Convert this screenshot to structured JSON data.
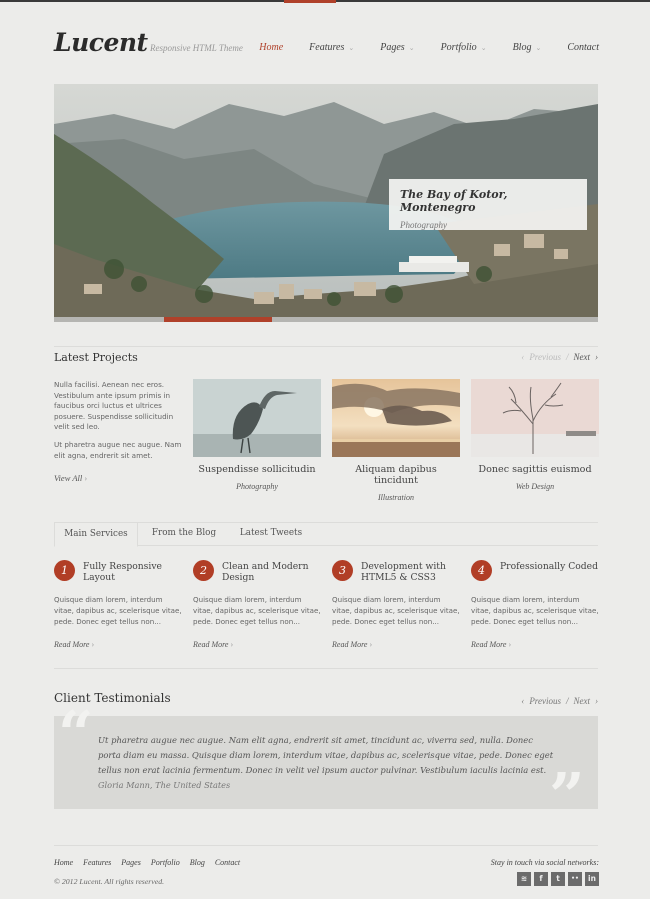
{
  "brand": {
    "logo": "Lucent",
    "tagline": "Responsive HTML Theme"
  },
  "nav": [
    {
      "label": "Home",
      "active": true,
      "has_submenu": false
    },
    {
      "label": "Features",
      "active": false,
      "has_submenu": true
    },
    {
      "label": "Pages",
      "active": false,
      "has_submenu": true
    },
    {
      "label": "Portfolio",
      "active": false,
      "has_submenu": true
    },
    {
      "label": "Blog",
      "active": false,
      "has_submenu": true
    },
    {
      "label": "Contact",
      "active": false,
      "has_submenu": false
    }
  ],
  "slider": {
    "caption_title": "The Bay of Kotor, Montenegro",
    "caption_subtitle": "Photography",
    "progress_fraction": 0.2
  },
  "latest_projects": {
    "title": "Latest Projects",
    "pager_prev": "Previous",
    "pager_sep": "/",
    "pager_next": "Next",
    "intro_p1": "Nulla facilisi. Aenean nec eros. Vestibulum ante ipsum primis in faucibus orci luctus et ultrices posuere. Suspendisse sollicitudin velit sed leo.",
    "intro_p2": "Ut pharetra augue nec augue. Nam elit agna, endrerit sit amet.",
    "view_all": "View All",
    "items": [
      {
        "name": "Suspendisse sollicitudin",
        "category": "Photography"
      },
      {
        "name": "Aliquam dapibus tincidunt",
        "category": "Illustration"
      },
      {
        "name": "Donec sagittis euismod",
        "category": "Web Design"
      }
    ]
  },
  "tabs": [
    {
      "label": "Main Services",
      "active": true
    },
    {
      "label": "From the Blog",
      "active": false
    },
    {
      "label": "Latest Tweets",
      "active": false
    }
  ],
  "services": [
    {
      "number": "1",
      "title": "Fully Responsive Layout",
      "description": "Quisque diam lorem, interdum vitae, dapibus ac, scelerisque vitae, pede. Donec eget tellus non...",
      "more": "Read More"
    },
    {
      "number": "2",
      "title": "Clean and Modern Design",
      "description": "Quisque diam lorem, interdum vitae, dapibus ac, scelerisque vitae, pede. Donec eget tellus non...",
      "more": "Read More"
    },
    {
      "number": "3",
      "title": "Development with HTML5 & CSS3",
      "description": "Quisque diam lorem, interdum vitae, dapibus ac, scelerisque vitae, pede. Donec eget tellus non...",
      "more": "Read More"
    },
    {
      "number": "4",
      "title": "Professionally Coded",
      "description": "Quisque diam lorem, interdum vitae, dapibus ac, scelerisque vitae, pede. Donec eget tellus non...",
      "more": "Read More"
    }
  ],
  "testimonials": {
    "title": "Client Testimonials",
    "pager_prev": "Previous",
    "pager_sep": "/",
    "pager_next": "Next",
    "quote": "Ut pharetra augue nec augue. Nam elit agna, endrerit sit amet, tincidunt ac, viverra sed, nulla. Donec porta diam eu massa. Quisque diam lorem, interdum vitae, dapibus ac, scelerisque vitae, pede. Donec eget tellus non erat lacinia fermentum. Donec in velit vel ipsum auctor pulvinar. Vestibulum iaculis lacinia est.",
    "author": "Gloria Mann, The United States"
  },
  "footer": {
    "nav": [
      "Home",
      "Features",
      "Pages",
      "Portfolio",
      "Blog",
      "Contact"
    ],
    "copyright": "© 2012 Lucent. All rights reserved.",
    "social_label": "Stay in touch via social networks:",
    "social": [
      {
        "icon": "rss-icon",
        "glyph": "≋"
      },
      {
        "icon": "facebook-icon",
        "glyph": "f"
      },
      {
        "icon": "twitter-icon",
        "glyph": "t"
      },
      {
        "icon": "flickr-icon",
        "glyph": "••"
      },
      {
        "icon": "linkedin-icon",
        "glyph": "in"
      }
    ]
  },
  "colors": {
    "accent": "#b0412a",
    "background": "#ececea",
    "quote_box": "#d9d9d6"
  }
}
